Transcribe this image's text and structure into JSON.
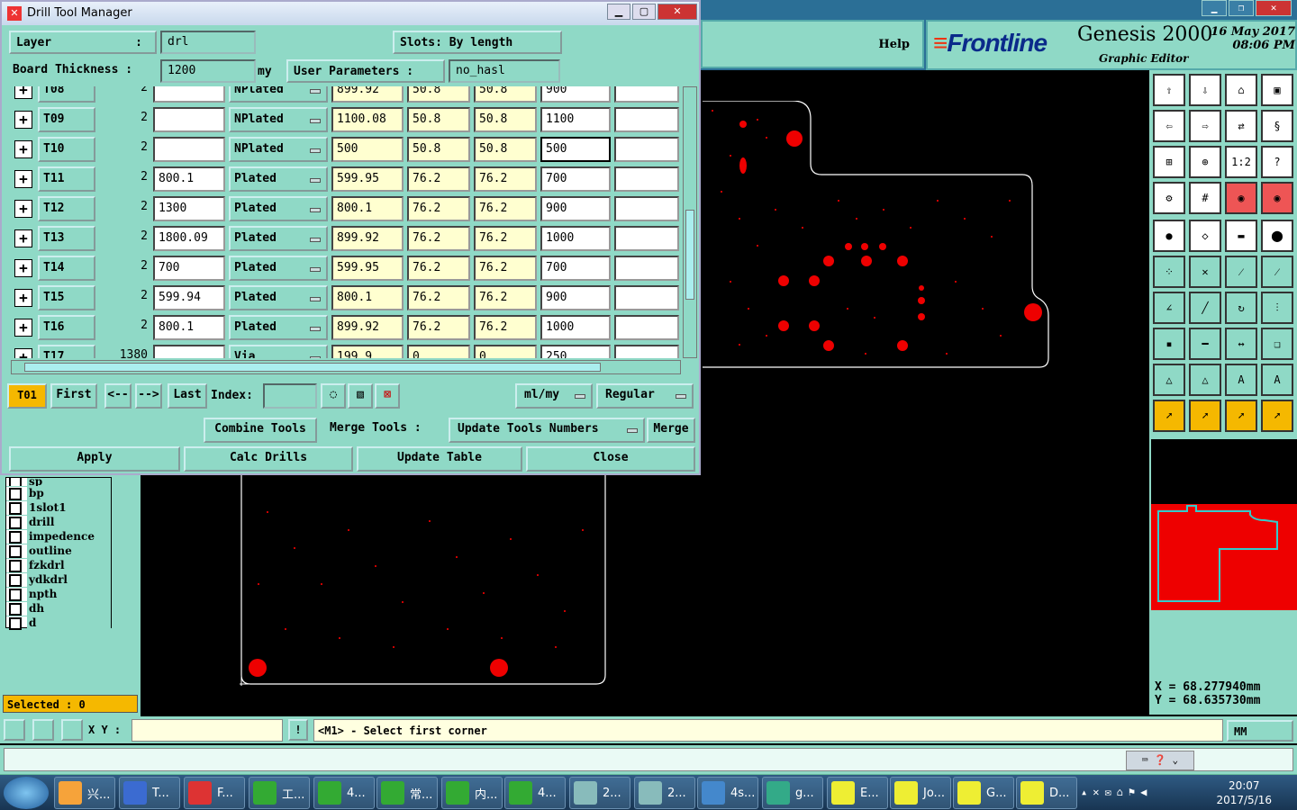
{
  "dialog": {
    "title": "Drill Tool Manager",
    "layer_label": "Layer",
    "layer_colon": ":",
    "layer_value": "drl",
    "slots_label": "Slots:",
    "slots_value": "By length",
    "thickness_label": "Board Thickness :",
    "thickness_value": "1200",
    "thickness_unit": "my",
    "user_params_label": "User Parameters :",
    "user_params_value": "no_hasl",
    "rows": [
      {
        "tool": "T08",
        "count": "2",
        "c1": "",
        "type": "NPlated",
        "c2": "899.92",
        "c3": "50.8",
        "c4": "50.8",
        "c5": "900",
        "c6": ""
      },
      {
        "tool": "T09",
        "count": "2",
        "c1": "",
        "type": "NPlated",
        "c2": "1100.08",
        "c3": "50.8",
        "c4": "50.8",
        "c5": "1100",
        "c6": ""
      },
      {
        "tool": "T10",
        "count": "2",
        "c1": "",
        "type": "NPlated",
        "c2": "500",
        "c3": "50.8",
        "c4": "50.8",
        "c5": "500",
        "c6": ""
      },
      {
        "tool": "T11",
        "count": "2",
        "c1": "800.1",
        "type": "Plated",
        "c2": "599.95",
        "c3": "76.2",
        "c4": "76.2",
        "c5": "700",
        "c6": ""
      },
      {
        "tool": "T12",
        "count": "2",
        "c1": "1300",
        "type": "Plated",
        "c2": "800.1",
        "c3": "76.2",
        "c4": "76.2",
        "c5": "900",
        "c6": ""
      },
      {
        "tool": "T13",
        "count": "2",
        "c1": "1800.09",
        "type": "Plated",
        "c2": "899.92",
        "c3": "76.2",
        "c4": "76.2",
        "c5": "1000",
        "c6": ""
      },
      {
        "tool": "T14",
        "count": "2",
        "c1": "700",
        "type": "Plated",
        "c2": "599.95",
        "c3": "76.2",
        "c4": "76.2",
        "c5": "700",
        "c6": ""
      },
      {
        "tool": "T15",
        "count": "2",
        "c1": "599.94",
        "type": "Plated",
        "c2": "800.1",
        "c3": "76.2",
        "c4": "76.2",
        "c5": "900",
        "c6": ""
      },
      {
        "tool": "T16",
        "count": "2",
        "c1": "800.1",
        "type": "Plated",
        "c2": "899.92",
        "c3": "76.2",
        "c4": "76.2",
        "c5": "1000",
        "c6": ""
      },
      {
        "tool": "T17",
        "count": "1380",
        "c1": "",
        "type": "Via",
        "c2": "199.9",
        "c3": "0",
        "c4": "0",
        "c5": "250",
        "c6": ""
      }
    ],
    "current_tool": "T01",
    "nav_first": "First",
    "nav_prev": "<--",
    "nav_next": "-->",
    "nav_last": "Last",
    "index_label": "Index:",
    "units_value": "ml/my",
    "mode_value": "Regular",
    "combine_tools": "Combine Tools",
    "merge_tools_label": "Merge Tools :",
    "update_tools_numbers": "Update Tools Numbers",
    "merge": "Merge",
    "apply": "Apply",
    "calc_drills": "Calc Drills",
    "update_table": "Update Table",
    "close": "Close"
  },
  "header": {
    "help": "Help",
    "brand": "Frontline",
    "product": "Genesis 2000",
    "subtitle": "Graphic Editor",
    "date": "16 May 2017",
    "time": "08:06 PM"
  },
  "layers": [
    "sp",
    "bp",
    "1slot1",
    "drill",
    "impedence",
    "outline",
    "fzkdrl",
    "ydkdrl",
    "npth",
    "dh",
    "d"
  ],
  "selected": "Selected : 0",
  "coords": {
    "x": "X = 68.277940mm",
    "y": "Y = 68.635730mm"
  },
  "bottom": {
    "xy_label": "X Y :",
    "message": "<M1> - Select first corner",
    "units": "MM"
  },
  "taskbar": {
    "items": [
      "兴...",
      "T...",
      "F...",
      "工...",
      "4...",
      "常...",
      "内...",
      "4...",
      "2...",
      "2...",
      "4s...",
      "g...",
      "E...",
      "Jo...",
      "G...",
      "D..."
    ],
    "time": "20:07",
    "date": "2017/5/16"
  },
  "colors": {
    "panel": "#8fd9c6",
    "accent": "#f5b800",
    "board": "#ff0000",
    "outline": "#ffffff"
  }
}
